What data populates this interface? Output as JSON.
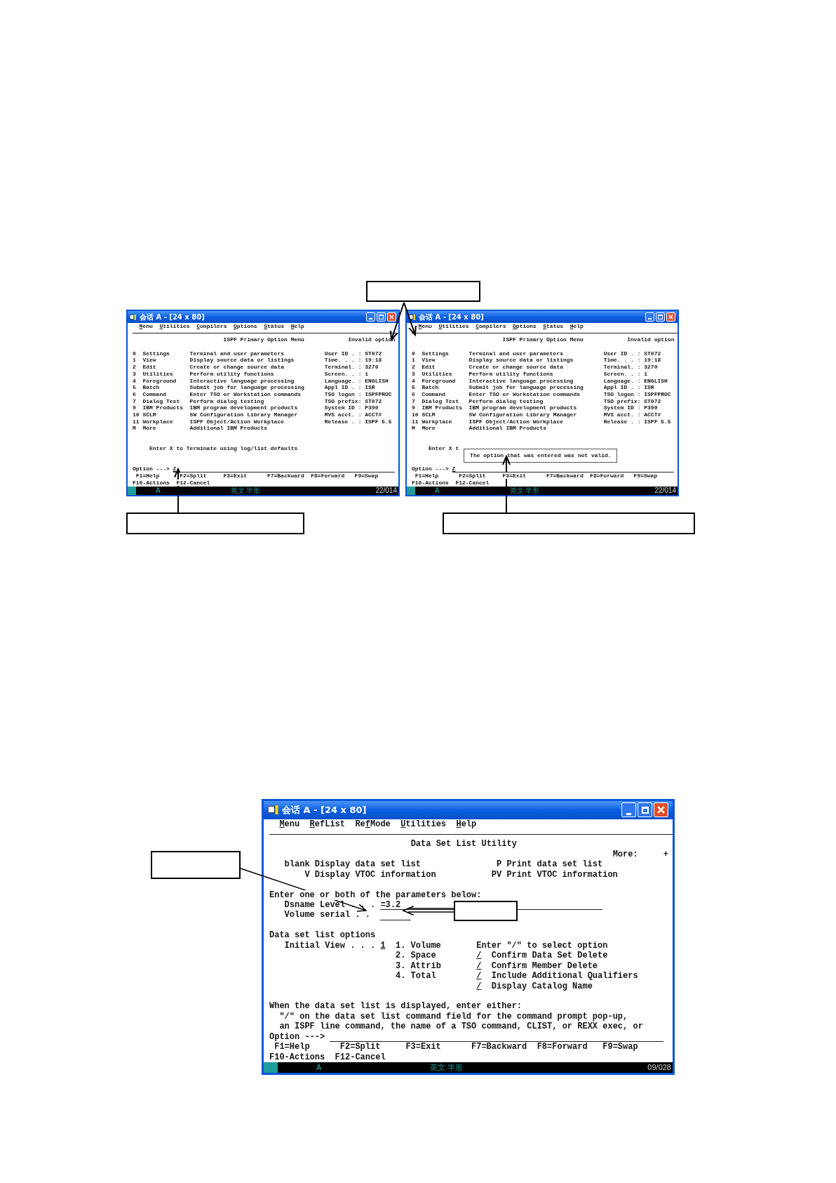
{
  "figure_top": {
    "windows": [
      {
        "title": "会话 A - [24 x 80]",
        "menu": [
          {
            "key": "M",
            "rest": "enu"
          },
          {
            "key": "U",
            "rest": "tilities"
          },
          {
            "key": "C",
            "rest": "ompilers"
          },
          {
            "key": "O",
            "rest": "ptions"
          },
          {
            "key": "S",
            "rest": "tatus"
          },
          {
            "key": "H",
            "rest": "elp"
          }
        ],
        "screen_title": "ISPF Primary Option Menu",
        "message": "Invalid option",
        "options": [
          {
            "number": "0",
            "name": "Settings",
            "description": "Terminal and user parameters"
          },
          {
            "number": "1",
            "name": "View",
            "description": "Display source data or listings"
          },
          {
            "number": "2",
            "name": "Edit",
            "description": "Create or change source data"
          },
          {
            "number": "3",
            "name": "Utilities",
            "description": "Perform utility functions"
          },
          {
            "number": "4",
            "name": "Foreground",
            "description": "Interactive language processing"
          },
          {
            "number": "5",
            "name": "Batch",
            "description": "Submit job for language processing"
          },
          {
            "number": "6",
            "name": "Command",
            "description": "Enter TSO or Workstation commands"
          },
          {
            "number": "7",
            "name": "Dialog Test",
            "description": "Perform dialog testing"
          },
          {
            "number": "9",
            "name": "IBM Products",
            "description": "IBM program development products"
          },
          {
            "number": "10",
            "name": "SCLM",
            "description": "SW Configuration Library Manager"
          },
          {
            "number": "11",
            "name": "Workplace",
            "description": "ISPF Object/Action Workplace"
          },
          {
            "number": "M",
            "name": "More",
            "description": "Additional IBM Products"
          }
        ],
        "info": [
          {
            "label": "User ID . :",
            "value": "ST072"
          },
          {
            "label": "Time. . . :",
            "value": "19:18"
          },
          {
            "label": "Terminal. :",
            "value": "3270"
          },
          {
            "label": "Screen. . :",
            "value": "1"
          },
          {
            "label": "Language. :",
            "value": "ENGLISH"
          },
          {
            "label": "Appl ID . :",
            "value": "ISR"
          },
          {
            "label": "TSO logon :",
            "value": "ISPFPROC"
          },
          {
            "label": "TSO prefix:",
            "value": "ST072"
          },
          {
            "label": "System ID :",
            "value": "P390"
          },
          {
            "label": "MVS acct. :",
            "value": "ACCT#"
          },
          {
            "label": "Release . :",
            "value": "ISPF 5.5"
          }
        ],
        "prompt": "Enter X to Terminate using log/list defaults",
        "command": {
          "label": "Option --->",
          "value": "Z"
        },
        "function_key_rows": [
          [
            "F1=Help",
            "F2=Split",
            "F3=Exit",
            "F7=Backward",
            "F8=Forward",
            "F9=Swap"
          ],
          [
            "F10-Actions",
            "F12-Cancel"
          ]
        ],
        "status_bar": {
          "mode": "A",
          "input_method": "英文 半形",
          "cursor": "22/014"
        }
      },
      {
        "title": "会话 A - [24 x 80]",
        "menu": [
          {
            "key": "M",
            "rest": "enu"
          },
          {
            "key": "U",
            "rest": "tilities"
          },
          {
            "key": "C",
            "rest": "ompilers"
          },
          {
            "key": "O",
            "rest": "ptions"
          },
          {
            "key": "S",
            "rest": "tatus"
          },
          {
            "key": "H",
            "rest": "elp"
          }
        ],
        "screen_title": "ISPF Primary Option Menu",
        "message": "Invalid option",
        "options": [
          {
            "number": "0",
            "name": "Settings",
            "description": "Terminal and user parameters"
          },
          {
            "number": "1",
            "name": "View",
            "description": "Display source data or listings"
          },
          {
            "number": "2",
            "name": "Edit",
            "description": "Create or change source data"
          },
          {
            "number": "3",
            "name": "Utilities",
            "description": "Perform utility functions"
          },
          {
            "number": "4",
            "name": "Foreground",
            "description": "Interactive language processing"
          },
          {
            "number": "5",
            "name": "Batch",
            "description": "Submit job for language processing"
          },
          {
            "number": "6",
            "name": "Command",
            "description": "Enter TSO or Workstation commands"
          },
          {
            "number": "7",
            "name": "Dialog Test",
            "description": "Perform dialog testing"
          },
          {
            "number": "9",
            "name": "IBM Products",
            "description": "IBM program development products"
          },
          {
            "number": "10",
            "name": "SCLM",
            "description": "SW Configuration Library Manager"
          },
          {
            "number": "11",
            "name": "Workplace",
            "description": "ISPF Object/Action Workplace"
          },
          {
            "number": "M",
            "name": "More",
            "description": "Additional IBM Products"
          }
        ],
        "info": [
          {
            "label": "User ID . :",
            "value": "ST072"
          },
          {
            "label": "Time. . . :",
            "value": "19:18"
          },
          {
            "label": "Terminal. :",
            "value": "3270"
          },
          {
            "label": "Screen. . :",
            "value": "1"
          },
          {
            "label": "Language. :",
            "value": "ENGLISH"
          },
          {
            "label": "Appl ID . :",
            "value": "ISR"
          },
          {
            "label": "TSO logon :",
            "value": "ISPFPROC"
          },
          {
            "label": "TSO prefix:",
            "value": "ST072"
          },
          {
            "label": "System ID :",
            "value": "P390"
          },
          {
            "label": "MVS acct. :",
            "value": "ACCT#"
          },
          {
            "label": "Release . :",
            "value": "ISPF 5.5"
          }
        ],
        "prompt": "Enter X t",
        "popup": "The option that was entered was not valid.",
        "command": {
          "label": "Option --->",
          "value": "Z"
        },
        "function_key_rows": [
          [
            "F1=Help",
            "F2=Split",
            "F3=Exit",
            "F7=Backward",
            "F8=Forward",
            "F9=Swap"
          ],
          [
            "F10-Actions",
            "F12-Cancel"
          ]
        ],
        "status_bar": {
          "mode": "A",
          "input_method": "英文 半形",
          "cursor": "22/014"
        }
      }
    ]
  },
  "figure_bottom": {
    "window": {
      "title": "会话 A - [24 x 80]",
      "menu": [
        {
          "key": "M",
          "rest": "enu"
        },
        {
          "key": "R",
          "rest": "efList"
        },
        {
          "pre": "Re",
          "key": "f",
          "rest": "Mode"
        },
        {
          "key": "U",
          "rest": "tilities"
        },
        {
          "key": "H",
          "rest": "elp"
        }
      ],
      "screen_title": "Data Set List Utility",
      "more": "More:",
      "more_mark": "+",
      "action_rows": [
        [
          {
            "code": "blank",
            "text": "Display data set list"
          },
          {
            "code": "P",
            "text": "Print data set list"
          }
        ],
        [
          {
            "code": "V",
            "text": "Display VTOC information"
          },
          {
            "code": "PV",
            "text": "Print VTOC information"
          }
        ]
      ],
      "parameters_prompt": "Enter one or both of the parameters below:",
      "fields": [
        {
          "label": "Dsname Level . . .",
          "value": "=3.2"
        },
        {
          "label": "Volume serial . ."
        }
      ],
      "list_options_title": "Data set list options",
      "initial_view": {
        "label": "Initial View . . .",
        "value": "1"
      },
      "views": [
        "1. Volume",
        "2. Space",
        "3. Attrib",
        "4. Total"
      ],
      "select_hint": "Enter \"/\" to select option",
      "select_options": [
        {
          "mark": "/",
          "label": "Confirm Data Set Delete"
        },
        {
          "mark": "/",
          "label": "Confirm Member Delete"
        },
        {
          "mark": "/",
          "label": "Include Additional Qualifiers"
        },
        {
          "mark": "/",
          "label": "Display Catalog Name"
        }
      ],
      "help_lines": [
        "When the data set list is displayed, enter either:",
        "\"/\" on the data set list command field for the command prompt pop-up,",
        "an ISPF line command, the name of a TSO command, CLIST, or REXX exec, or"
      ],
      "command": {
        "label": "Option --->"
      },
      "function_key_rows": [
        [
          "F1=Help",
          "F2=Split",
          "F3=Exit",
          "F7=Backward",
          "F8=Forward",
          "F9=Swap"
        ],
        [
          "F10-Actions",
          "F12-Cancel"
        ]
      ],
      "status_bar": {
        "mode": "A",
        "input_method": "英文 半形",
        "cursor": "09/028"
      }
    }
  }
}
